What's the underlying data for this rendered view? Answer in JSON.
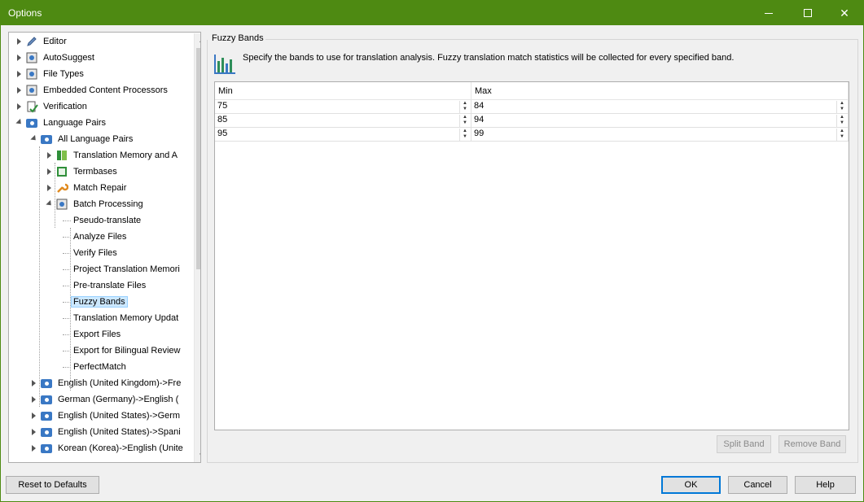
{
  "window": {
    "title": "Options"
  },
  "tree": {
    "items": [
      {
        "label": "Editor",
        "level": 0,
        "icon": "pencil-icon",
        "expander": "closed"
      },
      {
        "label": "AutoSuggest",
        "level": 0,
        "icon": "autosuggest-icon",
        "expander": "closed"
      },
      {
        "label": "File Types",
        "level": 0,
        "icon": "file-types-icon",
        "expander": "closed"
      },
      {
        "label": "Embedded Content Processors",
        "level": 0,
        "icon": "embedded-icon",
        "expander": "closed"
      },
      {
        "label": "Verification",
        "level": 0,
        "icon": "verification-icon",
        "expander": "closed"
      },
      {
        "label": "Language Pairs",
        "level": 0,
        "icon": "language-pair-icon",
        "expander": "open"
      },
      {
        "label": "All Language Pairs",
        "level": 1,
        "icon": "language-pair-icon",
        "expander": "open"
      },
      {
        "label": "Translation Memory and A",
        "level": 2,
        "icon": "translation-memory-icon",
        "expander": "closed"
      },
      {
        "label": "Termbases",
        "level": 2,
        "icon": "termbase-icon",
        "expander": "closed"
      },
      {
        "label": "Match Repair",
        "level": 2,
        "icon": "wrench-icon",
        "expander": "closed"
      },
      {
        "label": "Batch Processing",
        "level": 2,
        "icon": "batch-icon",
        "expander": "open"
      },
      {
        "label": "Pseudo-translate",
        "level": 3
      },
      {
        "label": "Analyze Files",
        "level": 3
      },
      {
        "label": "Verify Files",
        "level": 3
      },
      {
        "label": "Project Translation Memori",
        "level": 3
      },
      {
        "label": "Pre-translate Files",
        "level": 3
      },
      {
        "label": "Fuzzy Bands",
        "level": 3,
        "selected": true
      },
      {
        "label": "Translation Memory Updat",
        "level": 3
      },
      {
        "label": "Export Files",
        "level": 3
      },
      {
        "label": "Export for Bilingual Review",
        "level": 3
      },
      {
        "label": "PerfectMatch",
        "level": 3
      },
      {
        "label": "English (United Kingdom)->Fre",
        "level": 1,
        "icon": "language-pair-icon",
        "expander": "closed"
      },
      {
        "label": "German (Germany)->English (",
        "level": 1,
        "icon": "language-pair-icon",
        "expander": "closed"
      },
      {
        "label": "English (United States)->Germ",
        "level": 1,
        "icon": "language-pair-icon",
        "expander": "closed"
      },
      {
        "label": "English (United States)->Spani",
        "level": 1,
        "icon": "language-pair-icon",
        "expander": "closed"
      },
      {
        "label": "Korean (Korea)->English (Unite",
        "level": 1,
        "icon": "language-pair-icon",
        "expander": "closed"
      }
    ]
  },
  "panel": {
    "title": "Fuzzy Bands",
    "description": "Specify the bands to use for translation analysis. Fuzzy translation match statistics will be collected for every specified band.",
    "columns": [
      "Min",
      "Max"
    ],
    "rows": [
      {
        "min": "75",
        "max": "84"
      },
      {
        "min": "85",
        "max": "94"
      },
      {
        "min": "95",
        "max": "99"
      }
    ],
    "split_band": "Split Band",
    "remove_band": "Remove Band"
  },
  "footer": {
    "reset": "Reset to Defaults",
    "ok": "OK",
    "cancel": "Cancel",
    "help": "Help"
  }
}
